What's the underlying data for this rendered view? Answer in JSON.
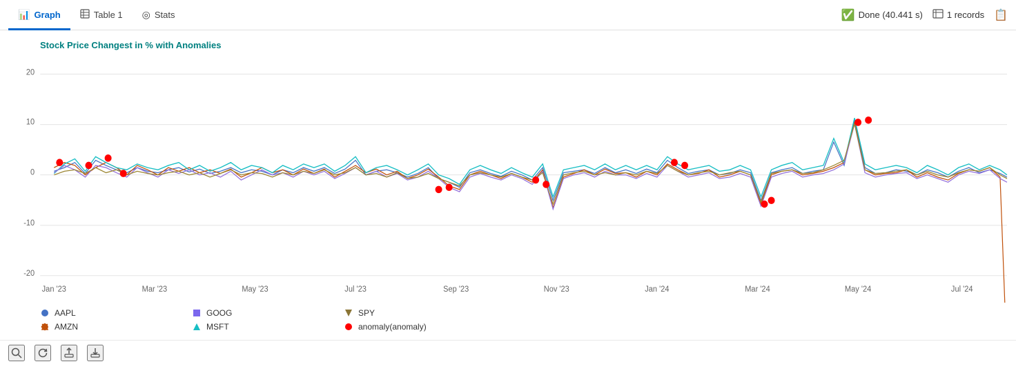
{
  "tabs": [
    {
      "id": "graph",
      "label": "Graph",
      "icon": "📊",
      "active": true
    },
    {
      "id": "table1",
      "label": "Table 1",
      "icon": "⊞",
      "active": false
    },
    {
      "id": "stats",
      "label": "Stats",
      "icon": "◎",
      "active": false
    }
  ],
  "status": {
    "done_label": "Done (40.441 s)",
    "records_label": "1 records"
  },
  "chart": {
    "title": "Stock Price Changest in % with Anomalies",
    "y_axis": {
      "max": 20,
      "mid_high": 10,
      "zero": 0,
      "mid_low": -10,
      "min": -20
    },
    "x_axis_labels": [
      "Jan '23",
      "Mar '23",
      "May '23",
      "Jul '23",
      "Sep '23",
      "Nov '23",
      "Jan '24",
      "Mar '24",
      "May '24",
      "Jul '24"
    ]
  },
  "legend": {
    "items": [
      {
        "symbol": "circle",
        "color": "#4472C4",
        "label": "AAPL"
      },
      {
        "symbol": "diamond",
        "color": "#C0500A",
        "label": "AMZN"
      },
      {
        "symbol": "square",
        "color": "#7B68EE",
        "label": "GOOG"
      },
      {
        "symbol": "triangle-up",
        "color": "#17BEC4",
        "label": "MSFT"
      },
      {
        "symbol": "triangle-down",
        "color": "#8B7536",
        "label": "SPY"
      },
      {
        "symbol": "circle",
        "color": "#FF0000",
        "label": "anomaly(anomaly)"
      }
    ]
  },
  "toolbar": {
    "search_label": "🔍",
    "refresh_label": "↺",
    "export_label": "⬆",
    "download_label": "⬇"
  }
}
